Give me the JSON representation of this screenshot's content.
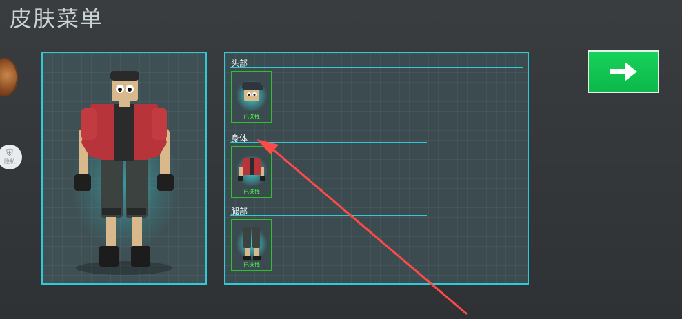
{
  "page": {
    "title": "皮肤菜单"
  },
  "sidebar": {
    "privacy_label": "隐私"
  },
  "skin_sections": [
    {
      "label": "头部",
      "slot_status": "已选择"
    },
    {
      "label": "身体",
      "slot_status": "已选择"
    },
    {
      "label": "腿部",
      "slot_status": "已选择"
    }
  ],
  "colors": {
    "accent": "#2fc9d8",
    "selected_border": "#2fbf2f",
    "next_button": "#12c852",
    "annotation_arrow": "#ff4a4a"
  },
  "icons": {
    "next": "arrow-right-icon",
    "privacy": "shield-icon"
  }
}
